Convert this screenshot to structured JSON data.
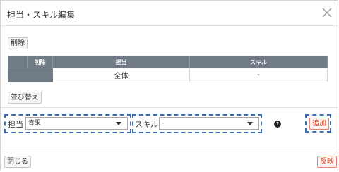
{
  "dialog": {
    "title": "担当・スキル編集",
    "close_icon": "close-icon"
  },
  "toolbar": {
    "delete_label": "削除",
    "sort_label": "並び替え"
  },
  "table": {
    "headers": [
      "",
      "削除",
      "担当",
      "スキル"
    ],
    "rows": [
      {
        "assignee": "全体",
        "skill": "-"
      }
    ]
  },
  "form": {
    "assignee_label": "担当",
    "assignee_value": "青果",
    "skill_label": "スキル",
    "skill_value": "-",
    "help_icon": "question-circle-icon",
    "add_label": "追加"
  },
  "footer": {
    "close_label": "閉じる",
    "apply_label": "反映"
  },
  "colors": {
    "header_bg": "#717b85",
    "highlight_dash": "#3d6cb5",
    "accent_red": "#d63f21"
  }
}
